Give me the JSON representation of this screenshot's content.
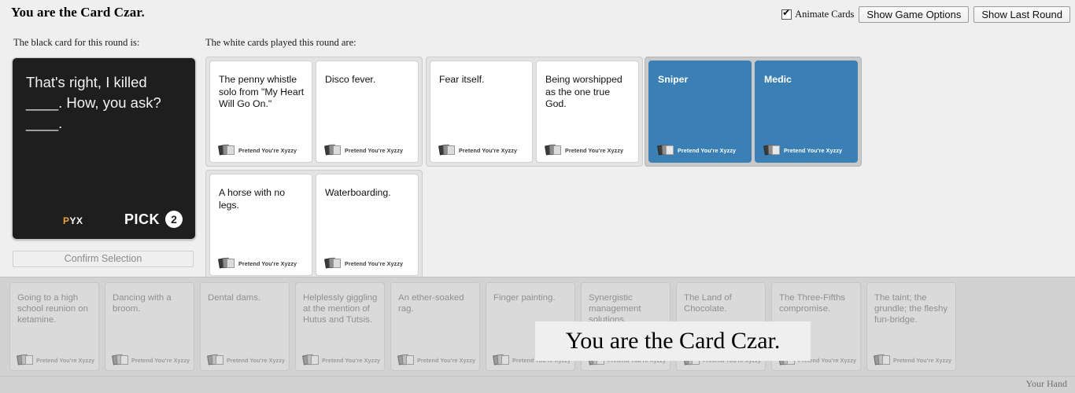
{
  "header": {
    "title": "You are the Card Czar.",
    "animate_cards_label": "Animate Cards",
    "animate_cards_checked": true,
    "show_game_options_label": "Show Game Options",
    "show_last_round_label": "Show Last Round"
  },
  "labels": {
    "black_card_label": "The black card for this round is:",
    "white_cards_label": "The white cards played this round are:",
    "your_hand_label": "Your Hand"
  },
  "black_card": {
    "text": "That's right, I killed ____. How, you ask? ____.",
    "brand_p": "P",
    "brand_yx": "YX",
    "pick_word": "PICK",
    "pick_count": "2"
  },
  "confirm_button": {
    "label": "Confirm Selection",
    "enabled": false
  },
  "card_footer_brand": "Pretend You're Xyzzy",
  "played_groups": [
    {
      "selected": false,
      "cards": [
        {
          "text": "The penny whistle solo from \"My Heart Will Go On.\""
        },
        {
          "text": "Disco fever."
        }
      ]
    },
    {
      "selected": false,
      "cards": [
        {
          "text": "Fear itself."
        },
        {
          "text": "Being worshipped as the one true God."
        }
      ]
    },
    {
      "selected": true,
      "cards": [
        {
          "text": "Sniper"
        },
        {
          "text": "Medic"
        }
      ]
    },
    {
      "selected": false,
      "cards": [
        {
          "text": "A horse with no legs."
        },
        {
          "text": "Waterboarding."
        }
      ]
    }
  ],
  "hand": [
    {
      "text": "Going to a high school reunion on ketamine."
    },
    {
      "text": "Dancing with a broom."
    },
    {
      "text": "Dental dams."
    },
    {
      "text": "Helplessly giggling at the mention of Hutus and Tutsis."
    },
    {
      "text": "An ether-soaked rag."
    },
    {
      "text": "Finger painting."
    },
    {
      "text": "Synergistic management solutions."
    },
    {
      "text": "The Land of Chocolate."
    },
    {
      "text": "The Three-Fifths compromise."
    },
    {
      "text": "The taint; the grundle; the fleshy fun-bridge."
    }
  ],
  "overlay": {
    "banner_text": "You are the Card Czar."
  },
  "colors": {
    "selected_card": "#3a80b5",
    "black_card": "#1e1e1e",
    "page_bg": "#efefef",
    "hand_bg": "#d2d2d2",
    "brand_orange": "#e8a33d"
  }
}
